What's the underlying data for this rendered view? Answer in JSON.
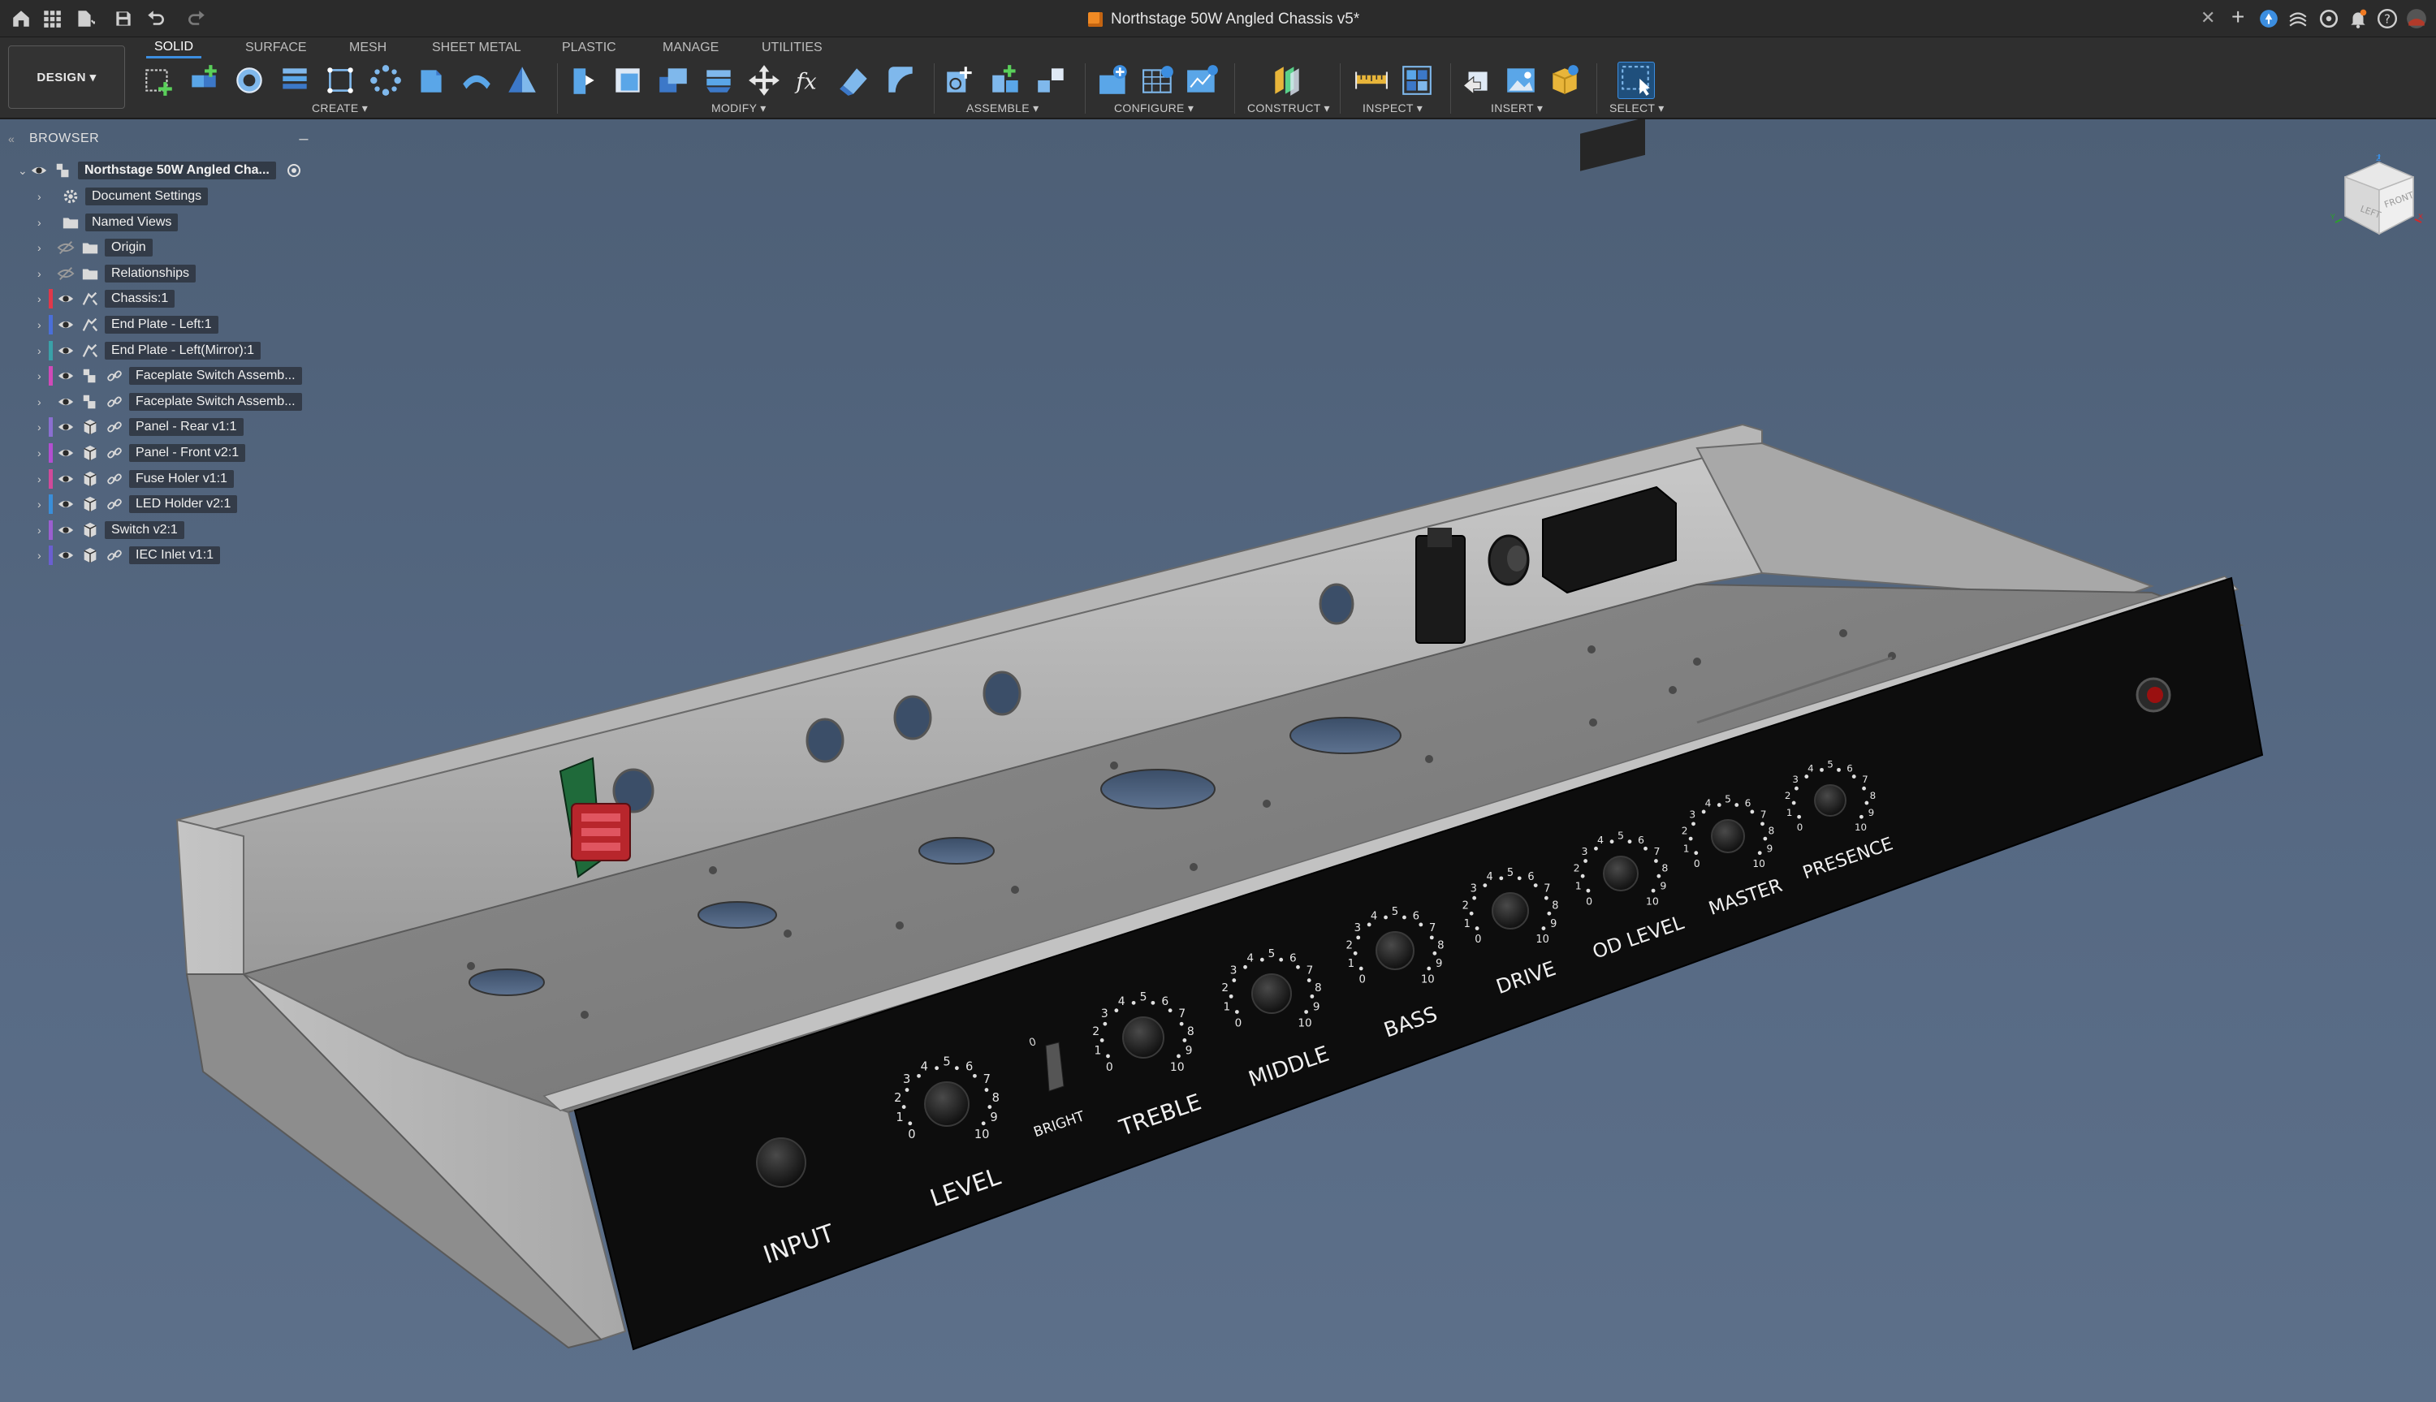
{
  "window": {
    "document_title": "Northstage 50W Angled Chassis v5*"
  },
  "toolbar": {
    "design_button": "DESIGN",
    "tabs": [
      "SOLID",
      "SURFACE",
      "MESH",
      "SHEET METAL",
      "PLASTIC",
      "MANAGE",
      "UTILITIES"
    ],
    "active_tab": "SOLID",
    "groups": [
      "CREATE",
      "MODIFY",
      "ASSEMBLE",
      "CONFIGURE",
      "CONSTRUCT",
      "INSPECT",
      "INSERT",
      "SELECT"
    ]
  },
  "browser": {
    "title": "BROWSER",
    "root": "Northstage 50W Angled Cha...",
    "items": [
      {
        "label": "Document Settings",
        "icon": "gear-icon",
        "color": ""
      },
      {
        "label": "Named Views",
        "icon": "folder-icon",
        "color": ""
      },
      {
        "label": "Origin",
        "icon": "folder-icon",
        "color": ""
      },
      {
        "label": "Relationships",
        "icon": "folder-icon",
        "color": ""
      },
      {
        "label": "Chassis:1",
        "icon": "sheet-metal-icon",
        "color": "#e0384a"
      },
      {
        "label": "End Plate - Left:1",
        "icon": "sheet-metal-icon",
        "color": "#4a6fd8"
      },
      {
        "label": "End Plate - Left(Mirror):1",
        "icon": "sheet-metal-icon",
        "color": "#3aa0a8"
      },
      {
        "label": "Faceplate Switch Assemb...",
        "icon": "assembly-icon",
        "color": "#d04ab8"
      },
      {
        "label": "Faceplate Switch Assemb...",
        "icon": "assembly-icon",
        "color": ""
      },
      {
        "label": "Panel - Rear v1:1",
        "icon": "component-icon",
        "color": "#8a6fd0"
      },
      {
        "label": "Panel - Front v2:1",
        "icon": "component-icon",
        "color": "#b24fd0"
      },
      {
        "label": "Fuse Holer v1:1",
        "icon": "component-icon",
        "color": "#d04a9a"
      },
      {
        "label": "LED Holder v2:1",
        "icon": "component-icon",
        "color": "#3a8ed8"
      },
      {
        "label": "Switch v2:1",
        "icon": "component-icon",
        "color": "#9a5fd0"
      },
      {
        "label": "IEC Inlet v1:1",
        "icon": "component-icon",
        "color": "#6a5fd0"
      }
    ]
  },
  "viewcube": {
    "left": "LEFT",
    "front": "FRONT"
  },
  "faceplate": {
    "labels": [
      "INPUT",
      "LEVEL",
      "BRIGHT",
      "TREBLE",
      "MIDDLE",
      "BASS",
      "DRIVE",
      "OD LEVEL",
      "MASTER",
      "PRESENCE"
    ],
    "dial_numbers": [
      "0",
      "1",
      "2",
      "3",
      "4",
      "5",
      "6",
      "7",
      "8",
      "9",
      "10"
    ]
  },
  "colors": {
    "accent": "#3c8ee0",
    "viewport_top": "#4d5f76",
    "faceplate": "#0d0d0d",
    "chassis": "#a3a3a3"
  }
}
